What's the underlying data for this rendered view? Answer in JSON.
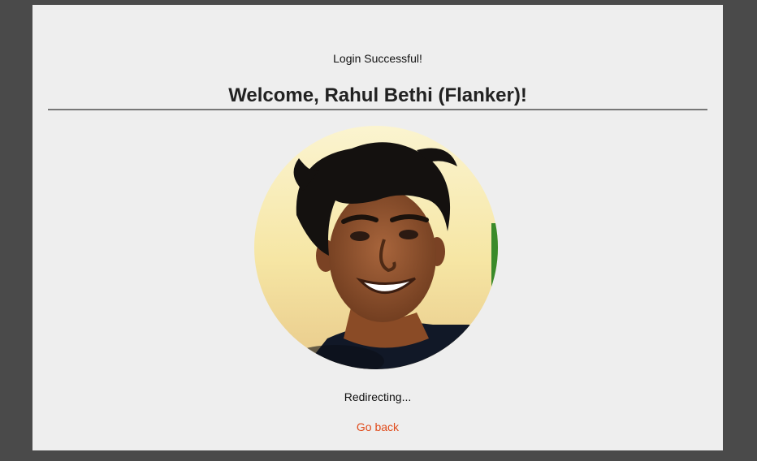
{
  "status_text": "Login Successful!",
  "welcome_title": "Welcome, Rahul Bethi (Flanker)!",
  "avatar_alt": "Profile photo",
  "redirect_text": "Redirecting...",
  "go_back_label": "Go back",
  "colors": {
    "frame": "#4a4a4a",
    "panel": "#eeeeee",
    "link": "#e04a1a",
    "divider": "#777777"
  }
}
